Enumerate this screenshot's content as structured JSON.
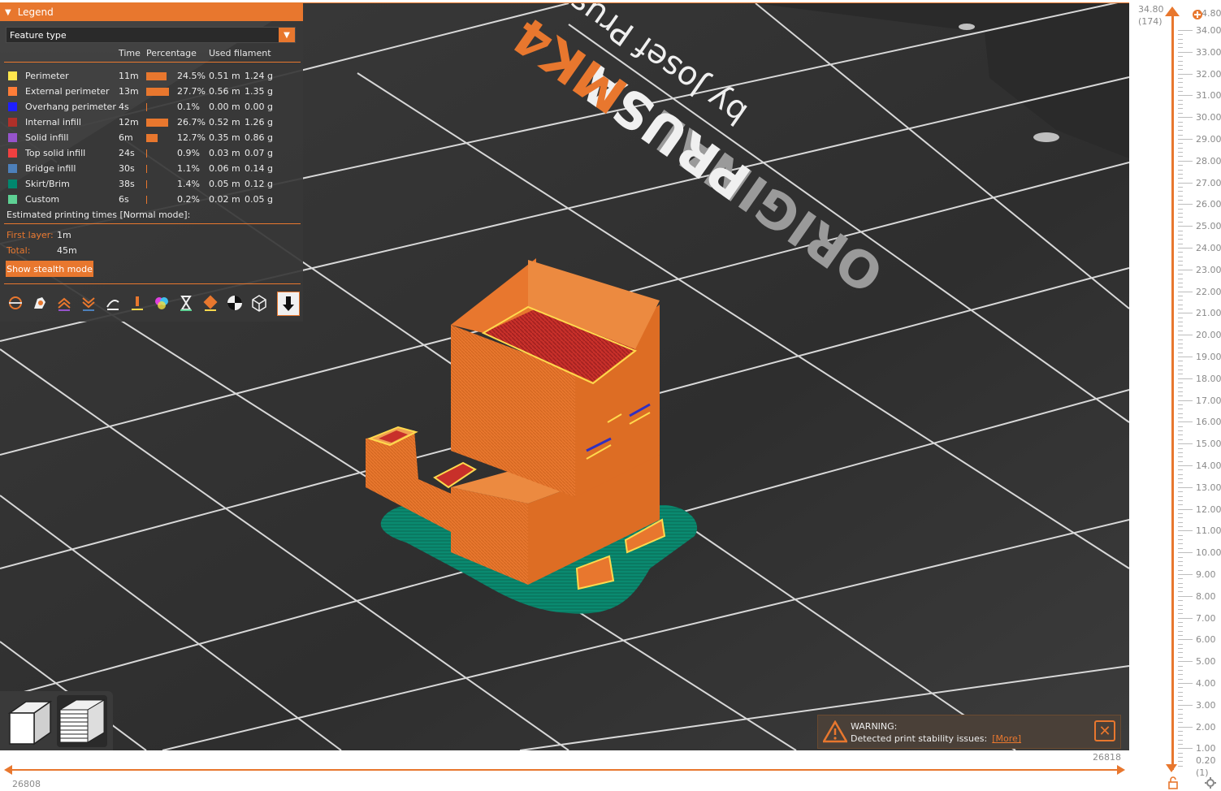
{
  "legend": {
    "title": "Legend",
    "view_type": "Feature type",
    "columns": [
      "Time",
      "Percentage",
      "Used filament"
    ],
    "features": [
      {
        "name": "Perimeter",
        "color": "#FFE64D",
        "time": "11m",
        "pct": "24.5%",
        "pct_value": 24.5,
        "length": "0.51 m",
        "weight": "1.24 g"
      },
      {
        "name": "External perimeter",
        "color": "#FF7D38",
        "time": "13m",
        "pct": "27.7%",
        "pct_value": 27.7,
        "length": "0.56 m",
        "weight": "1.35 g"
      },
      {
        "name": "Overhang perimeter",
        "color": "#1F1FFF",
        "time": "4s",
        "pct": "0.1%",
        "pct_value": 0.1,
        "length": "0.00 m",
        "weight": "0.00 g"
      },
      {
        "name": "Internal infill",
        "color": "#B03029",
        "time": "12m",
        "pct": "26.7%",
        "pct_value": 26.7,
        "length": "0.52 m",
        "weight": "1.26 g"
      },
      {
        "name": "Solid infill",
        "color": "#9654CC",
        "time": "6m",
        "pct": "12.7%",
        "pct_value": 12.7,
        "length": "0.35 m",
        "weight": "0.86 g"
      },
      {
        "name": "Top solid infill",
        "color": "#F04040",
        "time": "24s",
        "pct": "0.9%",
        "pct_value": 0.9,
        "length": "0.03 m",
        "weight": "0.07 g"
      },
      {
        "name": "Bridge infill",
        "color": "#4D80BA",
        "time": "30s",
        "pct": "1.1%",
        "pct_value": 1.1,
        "length": "0.06 m",
        "weight": "0.14 g"
      },
      {
        "name": "Skirt/Brim",
        "color": "#00876E",
        "time": "38s",
        "pct": "1.4%",
        "pct_value": 1.4,
        "length": "0.05 m",
        "weight": "0.12 g"
      },
      {
        "name": "Custom",
        "color": "#5ED194",
        "time": "6s",
        "pct": "0.2%",
        "pct_value": 0.2,
        "length": "0.02 m",
        "weight": "0.05 g"
      }
    ],
    "estimated_title": "Estimated printing times [Normal mode]:",
    "first_layer_label": "First layer:",
    "first_layer_value": "1m",
    "total_label": "Total:",
    "total_value": "45m",
    "stealth_button": "Show stealth mode",
    "toolbar_icons": [
      "travel-icon",
      "wipe-icon",
      "retractions-icon",
      "deretractions-icon",
      "seams-icon",
      "tool-changes-icon",
      "color-changes-icon",
      "pause-print-icon",
      "custom-gcode-icon",
      "center-of-gravity-icon",
      "shells-icon",
      "tool-marker-icon"
    ]
  },
  "bed": {
    "brand_line1": "ORIGINAL",
    "brand_line2": "PRUSA",
    "brand_model": "MK4",
    "brand_sub": "by Josef Prusa"
  },
  "vslider": {
    "top_value": "34.80",
    "top_layer": "(174)",
    "bottom_value": "0.20",
    "bottom_layer": "(1)",
    "ticks": [
      "34.00",
      "33.00",
      "32.00",
      "31.00",
      "30.00",
      "29.00",
      "28.00",
      "27.00",
      "26.00",
      "25.00",
      "24.00",
      "23.00",
      "22.00",
      "21.00",
      "20.00",
      "19.00",
      "18.00",
      "17.00",
      "16.00",
      "15.00",
      "14.00",
      "13.00",
      "12.00",
      "11.00",
      "10.00",
      "9.00",
      "8.00",
      "7.00",
      "6.00",
      "5.00",
      "4.00",
      "3.00",
      "2.00",
      "1.00"
    ],
    "top_thumb_label": "34.80"
  },
  "hslider": {
    "left_value": "26808",
    "right_value": "26818"
  },
  "warning": {
    "title": "WARNING:",
    "message": "Detected print stability issues:",
    "link": "[More]"
  },
  "colors": {
    "accent": "#e8772e",
    "bed": "#303030",
    "grid": "#e0e0e0",
    "model": "#e8772e"
  }
}
